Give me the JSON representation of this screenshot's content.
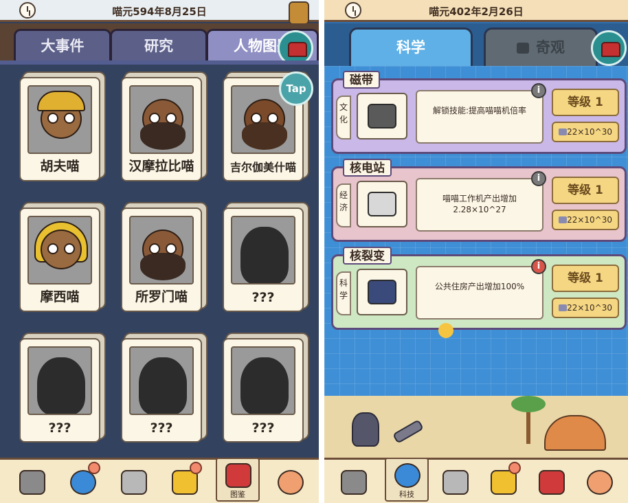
{
  "left": {
    "date": "喵元594年8月25日",
    "tabs": [
      {
        "label": "大事件"
      },
      {
        "label": "研究"
      },
      {
        "label": "人物图鉴"
      }
    ],
    "tap_label": "Tap",
    "cards": [
      {
        "name": "胡夫喵",
        "unlocked": true
      },
      {
        "name": "汉摩拉比喵",
        "unlocked": true
      },
      {
        "name": "吉尔伽美什喵",
        "unlocked": true
      },
      {
        "name": "摩西喵",
        "unlocked": true
      },
      {
        "name": "所罗门喵",
        "unlocked": true
      },
      {
        "name": "???",
        "unlocked": false
      },
      {
        "name": "???",
        "unlocked": false
      },
      {
        "name": "???",
        "unlocked": false
      },
      {
        "name": "???",
        "unlocked": false
      }
    ],
    "active_nav_label": "图鉴"
  },
  "right": {
    "date": "喵元402年2月26日",
    "tabs": [
      {
        "label": "科学",
        "locked": false
      },
      {
        "label": "奇观",
        "locked": true
      }
    ],
    "techs": [
      {
        "title": "磁带",
        "category": "文化",
        "description": "解锁技能:提高喵喵机倍率",
        "level": "等级 1",
        "cost": "4.22×10^30",
        "info_alert": false
      },
      {
        "title": "核电站",
        "category": "经济",
        "description": "喵喵工作机产出增加2.28×10^27",
        "level": "等级 1",
        "cost": "4.22×10^30",
        "info_alert": false
      },
      {
        "title": "核裂变",
        "category": "科学",
        "description": "公共住房产出增加100%",
        "level": "等级 1",
        "cost": "4.22×10^30",
        "info_alert": true
      }
    ],
    "active_nav_label": "科技"
  },
  "colors": {
    "left_bg": "#2f3f5c",
    "right_bg": "#3f8fd6",
    "tech_cards": [
      "#c9b8e8",
      "#e8c4cc",
      "#cfe8c4"
    ]
  }
}
